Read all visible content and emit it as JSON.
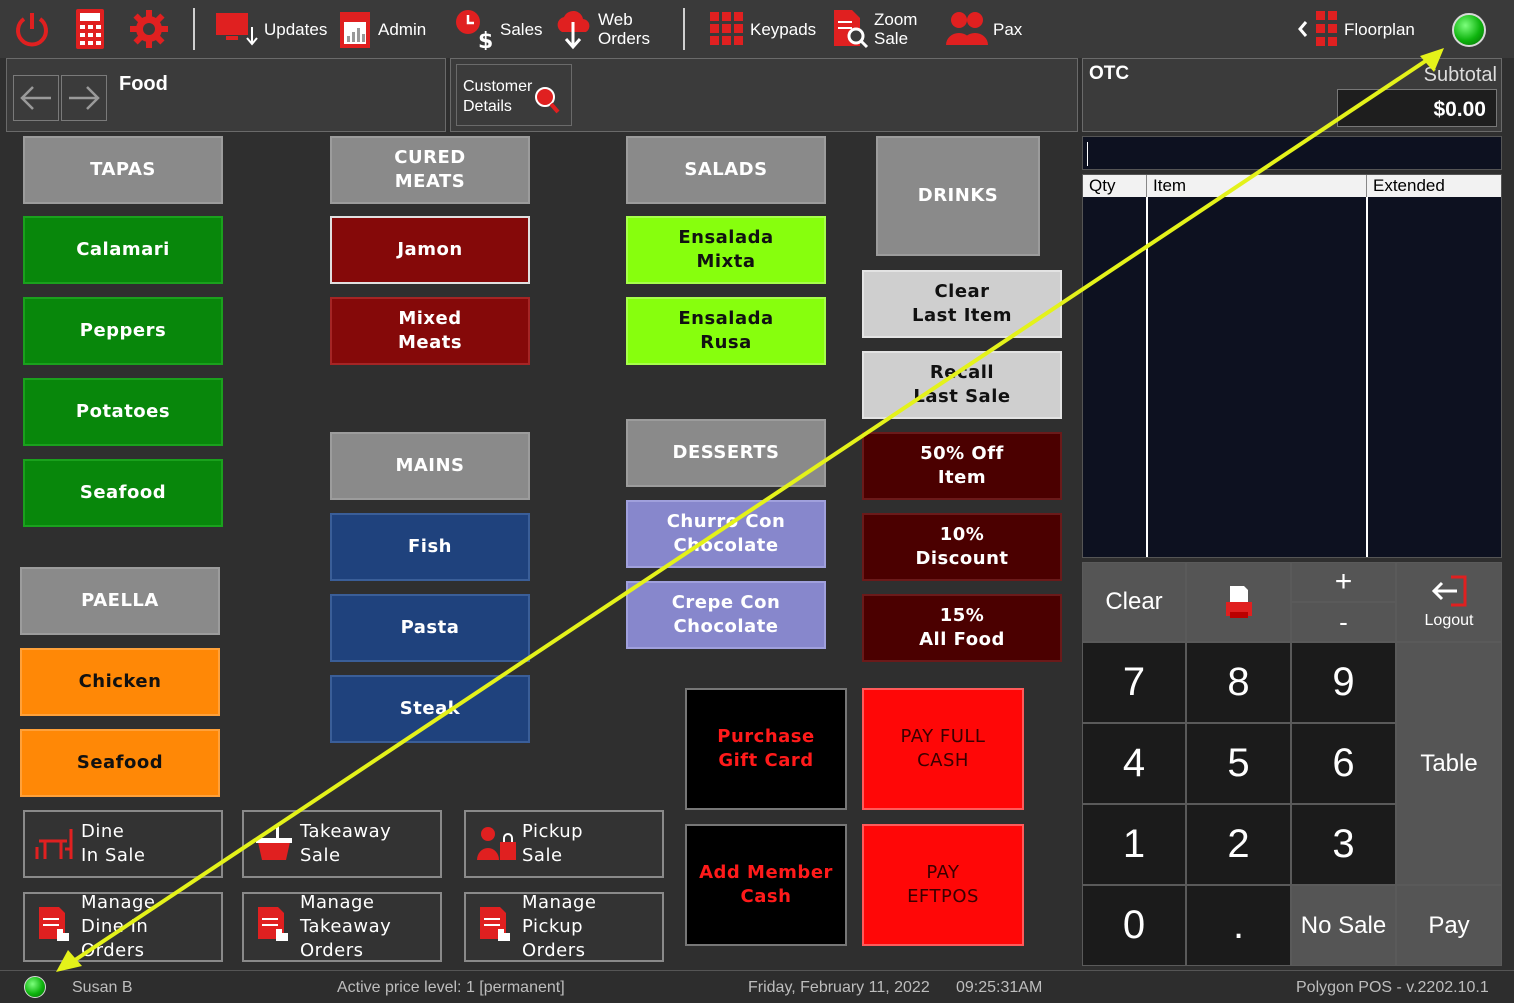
{
  "toolbar": {
    "updates": "Updates",
    "admin": "Admin",
    "sales": "Sales",
    "web_orders": "Web\nOrders",
    "keypads": "Keypads",
    "zoom_sale": "Zoom\nSale",
    "pax": "Pax",
    "floorplan": "Floorplan"
  },
  "nav": {
    "section_title": "Food",
    "customer_details": "Customer\nDetails"
  },
  "order": {
    "header": "OTC",
    "subtotal_label": "Subtotal",
    "subtotal_value": "$0.00",
    "columns": [
      "Qty",
      "Item",
      "Extended"
    ]
  },
  "menu": {
    "tapas": "TAPAS",
    "cured_meats": "CURED\nMEATS",
    "salads": "SALADS",
    "drinks": "DRINKS",
    "calamari": "Calamari",
    "peppers": "Peppers",
    "potatoes": "Potatoes",
    "seafood_tapas": "Seafood",
    "jamon": "Jamon",
    "mixed_meats": "Mixed\nMeats",
    "ensalada_mixta": "Ensalada\nMixta",
    "ensalada_rusa": "Ensalada\nRusa",
    "mains": "MAINS",
    "fish": "Fish",
    "pasta": "Pasta",
    "steak": "Steak",
    "desserts": "DESSERTS",
    "churro": "Churro Con\nChocolate",
    "crepe": "Crepe Con\nChocolate",
    "paella": "PAELLA",
    "chicken": "Chicken",
    "seafood_paella": "Seafood",
    "clear_last_item": "Clear\nLast Item",
    "recall_last_sale": "Recall\nLast Sale",
    "off50": "50% Off\nItem",
    "disc10": "10%\nDiscount",
    "food15": "15%\nAll Food",
    "purchase_gift_card": "Purchase\nGift Card",
    "pay_full_cash": "PAY FULL\nCASH",
    "add_member_cash": "Add Member\nCash",
    "pay_eftpos": "PAY\nEFTPOS",
    "dine_in_sale": "Dine\nIn Sale",
    "takeaway_sale": "Takeaway\nSale",
    "pickup_sale": "Pickup\nSale",
    "manage_dine_in": "Manage\nDine In\nOrders",
    "manage_takeaway": "Manage\nTakeaway\nOrders",
    "manage_pickup": "Manage\nPickup\nOrders"
  },
  "keypad": {
    "clear": "Clear",
    "plus": "+",
    "minus": "-",
    "logout": "Logout",
    "k7": "7",
    "k8": "8",
    "k9": "9",
    "k4": "4",
    "k5": "5",
    "k6": "6",
    "k1": "1",
    "k2": "2",
    "k3": "3",
    "k0": "0",
    "dot": ".",
    "table": "Table",
    "no_sale": "No Sale",
    "pay": "Pay"
  },
  "status": {
    "user": "Susan B",
    "price_level": "Active price level: 1 [permanent]",
    "date": "Friday, February 11, 2022",
    "time": "09:25:31AM",
    "version": "Polygon POS - v.2202.10.1"
  },
  "colors": {
    "background": "#2f2f2f",
    "green": "#08870b",
    "maroon": "#850909",
    "lime": "#87ff0d",
    "navy": "#1f427d",
    "lavender": "#8787cc",
    "orange": "#ff8806",
    "pay_red": "#ff0707",
    "annotation_arrow": "#e4f21a"
  }
}
